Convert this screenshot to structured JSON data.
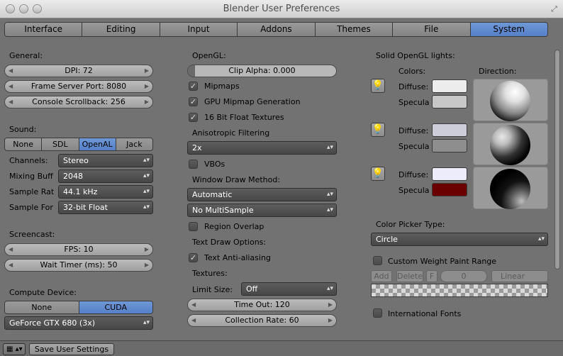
{
  "window": {
    "title": "Blender User Preferences"
  },
  "tabs": [
    {
      "label": "Interface"
    },
    {
      "label": "Editing"
    },
    {
      "label": "Input"
    },
    {
      "label": "Addons"
    },
    {
      "label": "Themes"
    },
    {
      "label": "File"
    },
    {
      "label": "System"
    }
  ],
  "active_tab": "System",
  "general": {
    "heading": "General:",
    "dpi": "DPI: 72",
    "frame_server_port": "Frame Server Port: 8080",
    "console_scrollback": "Console Scrollback: 256"
  },
  "sound": {
    "heading": "Sound:",
    "devices": [
      "None",
      "SDL",
      "OpenAL",
      "Jack"
    ],
    "selected_device": "OpenAL",
    "channels_label": "Channels:",
    "channels_value": "Stereo",
    "mixing_label": "Mixing Buff",
    "mixing_value": "2048",
    "sample_rate_label": "Sample Rat",
    "sample_rate_value": "44.1 kHz",
    "sample_format_label": "Sample For",
    "sample_format_value": "32-bit Float"
  },
  "screencast": {
    "heading": "Screencast:",
    "fps": "FPS: 10",
    "wait_timer": "Wait Timer (ms): 50"
  },
  "compute": {
    "heading": "Compute Device:",
    "options": [
      "None",
      "CUDA"
    ],
    "selected": "CUDA",
    "device": "GeForce GTX 680 (3x)"
  },
  "opengl": {
    "heading": "OpenGL:",
    "clip_alpha": "Clip Alpha: 0.000",
    "mipmaps": "Mipmaps",
    "gpu_mipmap": "GPU Mipmap Generation",
    "float_textures": "16 Bit Float Textures",
    "aniso_label": "Anisotropic Filtering",
    "aniso_value": "2x",
    "vbos": "VBOs",
    "window_draw_label": "Window Draw Method:",
    "window_draw_value": "Automatic",
    "multisample_value": "No MultiSample",
    "region_overlap": "Region Overlap",
    "text_draw_label": "Text Draw Options:",
    "text_antialias": "Text Anti-aliasing",
    "textures_label": "Textures:",
    "limit_size_label": "Limit Size:",
    "limit_size_value": "Off",
    "time_out": "Time Out: 120",
    "collection_rate": "Collection Rate: 60"
  },
  "checks": {
    "mipmaps": true,
    "gpu_mipmap": true,
    "float_textures": true,
    "vbos": false,
    "region_overlap": false,
    "text_antialias": true
  },
  "lights": {
    "heading": "Solid OpenGL lights:",
    "colors_label": "Colors:",
    "direction_label": "Direction:",
    "diffuse_label": "Diffuse:",
    "specular_label": "Specula",
    "items": [
      {
        "diffuse": "#ececec",
        "specular": "#c8c8c8"
      },
      {
        "diffuse": "#cdcdd9",
        "specular": "#8e8e8e"
      },
      {
        "diffuse": "#ececfa",
        "specular": "#6b0000"
      }
    ]
  },
  "color_picker": {
    "label": "Color Picker Type:",
    "value": "Circle"
  },
  "weight_paint": {
    "label": "Custom Weight Paint Range",
    "add": "Add",
    "delete": "Delete",
    "f": "F",
    "value": "0",
    "interp": "Linear"
  },
  "intl_fonts": "International Fonts",
  "footer": {
    "save": "Save User Settings"
  }
}
